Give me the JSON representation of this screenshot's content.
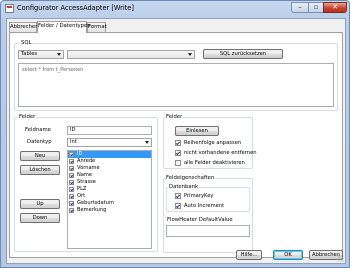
{
  "window": {
    "title": "Configurator AccessAdapter [Write]"
  },
  "tabs": [
    {
      "label": "Abbrechen"
    },
    {
      "label": "Felder / Datentypen"
    },
    {
      "label": "Format"
    }
  ],
  "sql": {
    "group_label": "SQL",
    "type_value": "Tables",
    "table_value": "",
    "reset_button": "SQL zurücksetzen",
    "query": "select * from t_Personen"
  },
  "felder_left": {
    "group_label": "Felder",
    "fieldname_label": "Feldname",
    "fieldname_value": "ID",
    "datatype_label": "Datentyp",
    "datatype_value": "Int",
    "btn_new": "Neu",
    "btn_delete": "Löschen",
    "btn_up": "Up",
    "btn_down": "Down",
    "fields": [
      {
        "label": "ID",
        "checked": true,
        "selected": true
      },
      {
        "label": "Anrede",
        "checked": true,
        "selected": false
      },
      {
        "label": "Vorname",
        "checked": true,
        "selected": false
      },
      {
        "label": "Name",
        "checked": true,
        "selected": false
      },
      {
        "label": "Strasse",
        "checked": true,
        "selected": false
      },
      {
        "label": "PLZ",
        "checked": true,
        "selected": false
      },
      {
        "label": "Ort",
        "checked": true,
        "selected": false
      },
      {
        "label": "Geburtsdatum",
        "checked": true,
        "selected": false
      },
      {
        "label": "Bemerkung",
        "checked": true,
        "selected": false
      }
    ]
  },
  "felder_right": {
    "group_label": "Felder",
    "read_button": "Einlesen",
    "options": [
      {
        "label": "Reihenfolge anpassen",
        "checked": true
      },
      {
        "label": "nicht vorhandene entfernen",
        "checked": true
      },
      {
        "label": "alle Felder deaktivieren",
        "checked": false
      }
    ]
  },
  "properties": {
    "group_label": "Feldeigenschaften",
    "database_label": "Datenbank",
    "options": [
      {
        "label": "PrimaryKey",
        "checked": true
      },
      {
        "label": "Auto Increment",
        "checked": true
      }
    ],
    "default_label": "FlowHeater DefaultValue",
    "default_value": ""
  },
  "footer": {
    "help": "Hilfe...",
    "ok": "OK",
    "cancel": "Abbrechen"
  },
  "colors": {
    "title_bar": "#c7d9ef",
    "selection": "#3399ff",
    "close_button": "#c9452f"
  }
}
